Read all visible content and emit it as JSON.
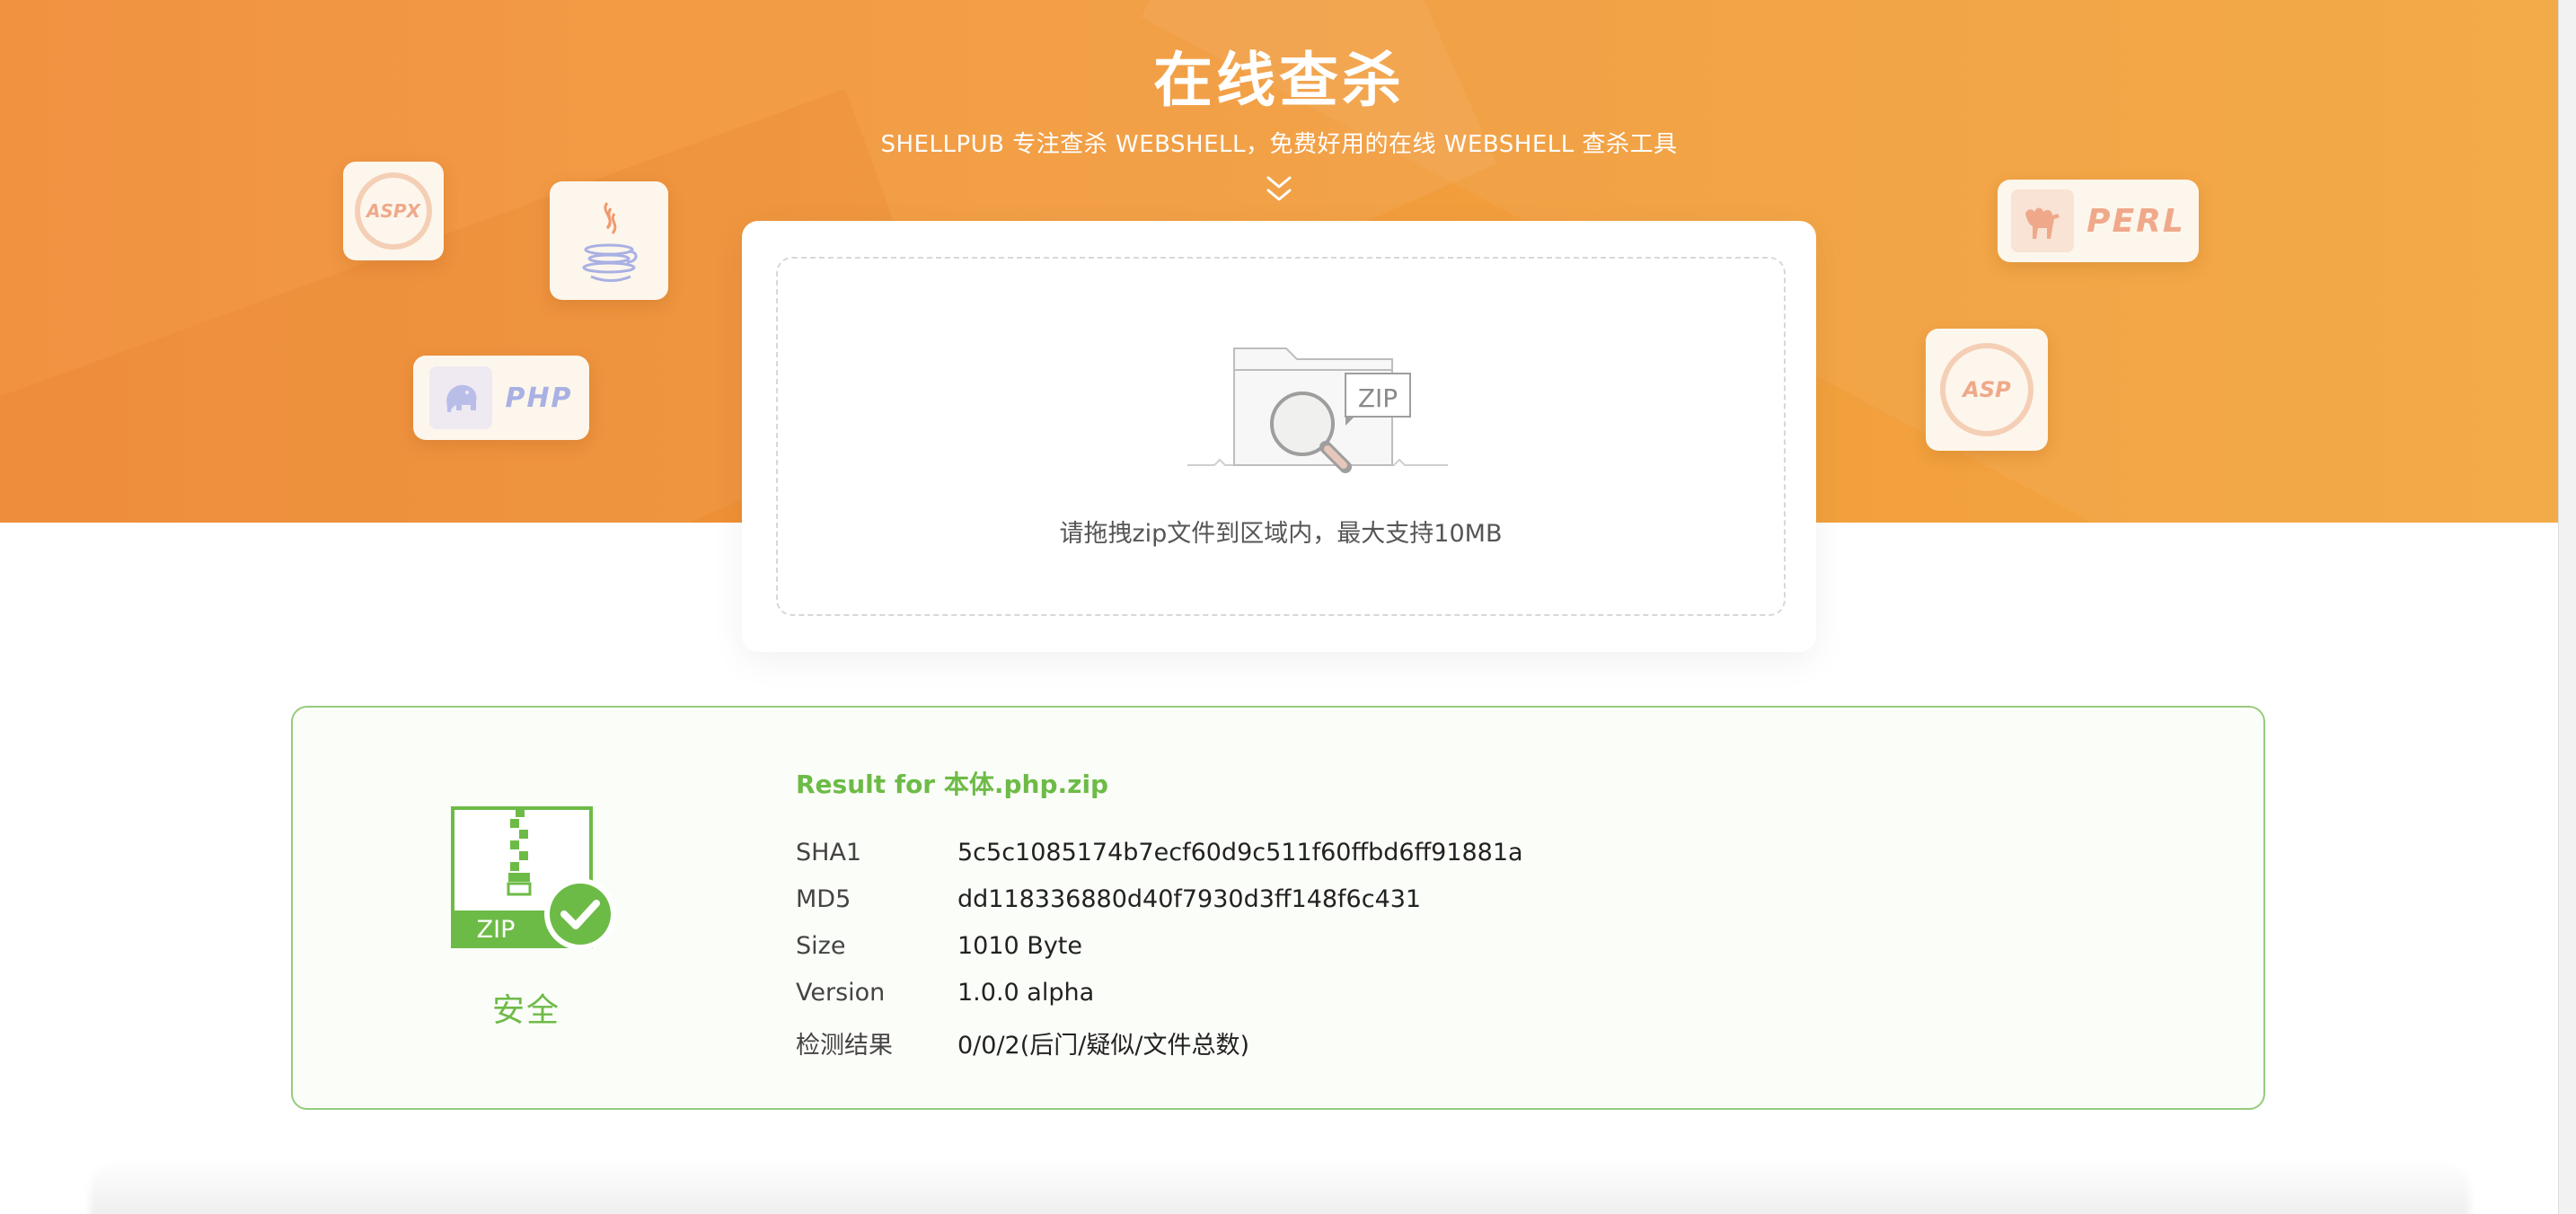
{
  "hero": {
    "title": "在线查杀",
    "subtitle": "SHELLPUB 专注查杀 WEBSHELL，免费好用的在线 WEBSHELL 查杀工具",
    "arrow_icon": "double-chevron-down-icon"
  },
  "language_logos": {
    "aspx": "ASPX",
    "java": "java-cup-icon",
    "php": "PHP",
    "perl": "PERL",
    "asp": "ASP"
  },
  "upload": {
    "zip_label": "ZIP",
    "hint": "请拖拽zip文件到区域内，最大支持10MB"
  },
  "result": {
    "title": "Result for 本体.php.zip",
    "status": "安全",
    "zip_label": "ZIP",
    "fields": [
      {
        "key": "SHA1",
        "value": "5c5c1085174b7ecf60d9c511f60ffbd6ff91881a"
      },
      {
        "key": "MD5",
        "value": "dd118336880d40f7930d3ff148f6c431"
      },
      {
        "key": "Size",
        "value": "1010 Byte"
      },
      {
        "key": "Version",
        "value": "1.0.0 alpha"
      },
      {
        "key": "检测结果",
        "value": "0/0/2(后门/疑似/文件总数)"
      }
    ]
  },
  "colors": {
    "brand_orange": "#f29b3c",
    "safe_green": "#6dbb47",
    "card_border_green": "#96cb7c"
  }
}
